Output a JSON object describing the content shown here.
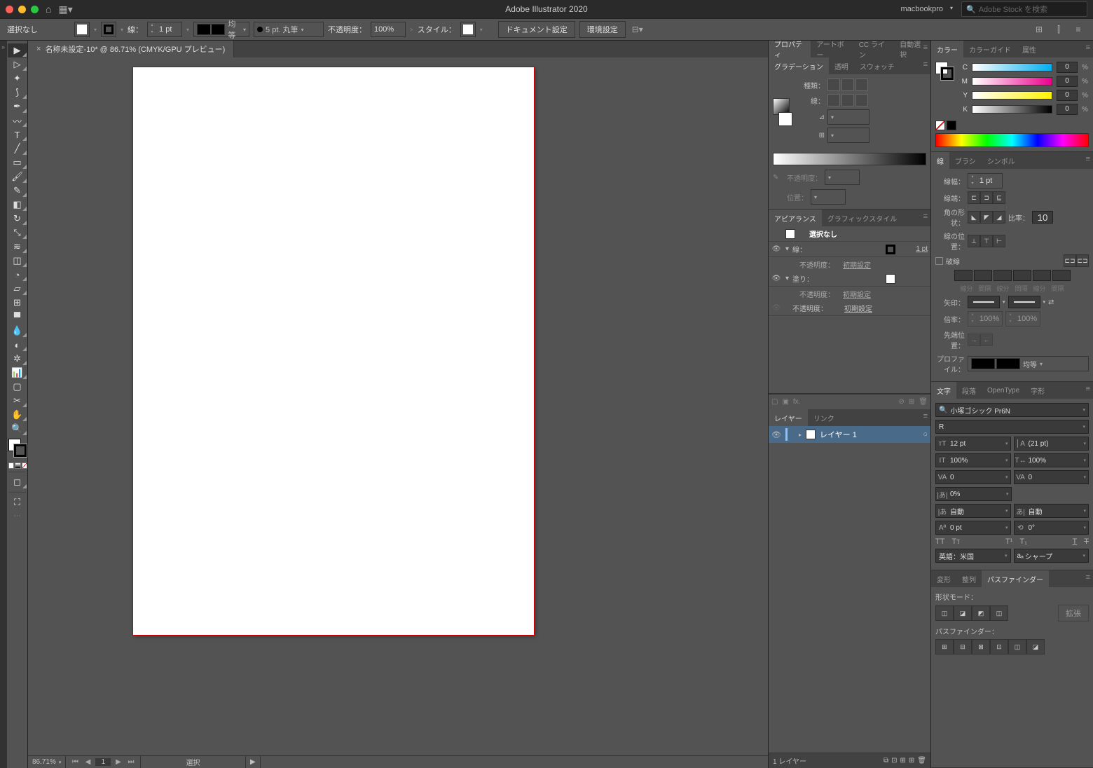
{
  "titlebar": {
    "app_title": "Adobe Illustrator 2020",
    "user": "macbookpro",
    "search_placeholder": "Adobe Stock を検索"
  },
  "control_bar": {
    "no_selection": "選択なし",
    "stroke_label": "線：",
    "stroke_weight": "1 pt",
    "profile": "均等",
    "brush": "5 pt. 丸筆",
    "opacity_label": "不透明度：",
    "opacity": "100%",
    "style_label": "スタイル：",
    "doc_setup": "ドキュメント設定",
    "prefs": "環境設定"
  },
  "doc_tab": {
    "name": "名称未設定-10* @ 86.71% (CMYK/GPU プレビュー)"
  },
  "status": {
    "zoom": "86.71%",
    "artboard": "1",
    "tool": "選択"
  },
  "colA": {
    "tabs1": [
      "プロパティ",
      "アートボー",
      "CC ライン",
      "自動選択"
    ],
    "tabs_grad": [
      "グラデーション",
      "透明",
      "スウォッチ"
    ],
    "grad": {
      "type_label": "種類：",
      "line_label": "線：",
      "angle_label": "⊿",
      "opacity_label": "不透明度：",
      "pos_label": "位置："
    },
    "tabs_app": [
      "アピアランス",
      "グラフィックスタイル"
    ],
    "appearance": {
      "no_sel": "選択なし",
      "stroke": "線：",
      "stroke_val": "1 pt",
      "opacity": "不透明度：",
      "default": "初期設定",
      "fill": "塗り："
    },
    "tabs_layer": [
      "レイヤー",
      "リンク"
    ],
    "layer_name": "レイヤー 1",
    "layer_count": "1 レイヤー"
  },
  "colB": {
    "tabs_color": [
      "カラー",
      "カラーガイド",
      "属性"
    ],
    "cmyk": {
      "c": "C",
      "m": "M",
      "y": "Y",
      "k": "K",
      "c_val": "0",
      "m_val": "0",
      "y_val": "0",
      "k_val": "0",
      "pct": "%"
    },
    "tabs_stroke": [
      "線",
      "ブラシ",
      "シンボル"
    ],
    "stroke": {
      "weight_label": "線幅：",
      "weight": "1 pt",
      "cap_label": "線端：",
      "corner_label": "角の形状：",
      "limit_label": "比率：",
      "limit": "10",
      "align_label": "線の位置：",
      "dashed": "破線",
      "dash_labels": [
        "線分",
        "間隔",
        "線分",
        "間隔",
        "線分",
        "間隔"
      ],
      "arrow_label": "矢印：",
      "scale_label": "倍率：",
      "scale": "100%",
      "align_arrow_label": "先端位置：",
      "profile_label": "プロファイル：",
      "profile": "均等"
    },
    "tabs_char": [
      "文字",
      "段落",
      "OpenType",
      "字形"
    ],
    "char": {
      "font": "小塚ゴシック Pr6N",
      "style": "R",
      "size": "12 pt",
      "leading": "(21 pt)",
      "vscale": "100%",
      "hscale": "100%",
      "kerning": "0",
      "tracking": "0",
      "baseline_pct": "0%",
      "auto1": "自動",
      "auto2": "自動",
      "baseline": "0 pt",
      "rotate": "0°",
      "lang": "英語：米国",
      "aa": "シャープ"
    },
    "tabs_pf": [
      "変形",
      "整列",
      "パスファインダー"
    ],
    "pf": {
      "shape_mode": "形状モード：",
      "expand": "拡張",
      "pathfinder": "パスファインダー："
    }
  }
}
